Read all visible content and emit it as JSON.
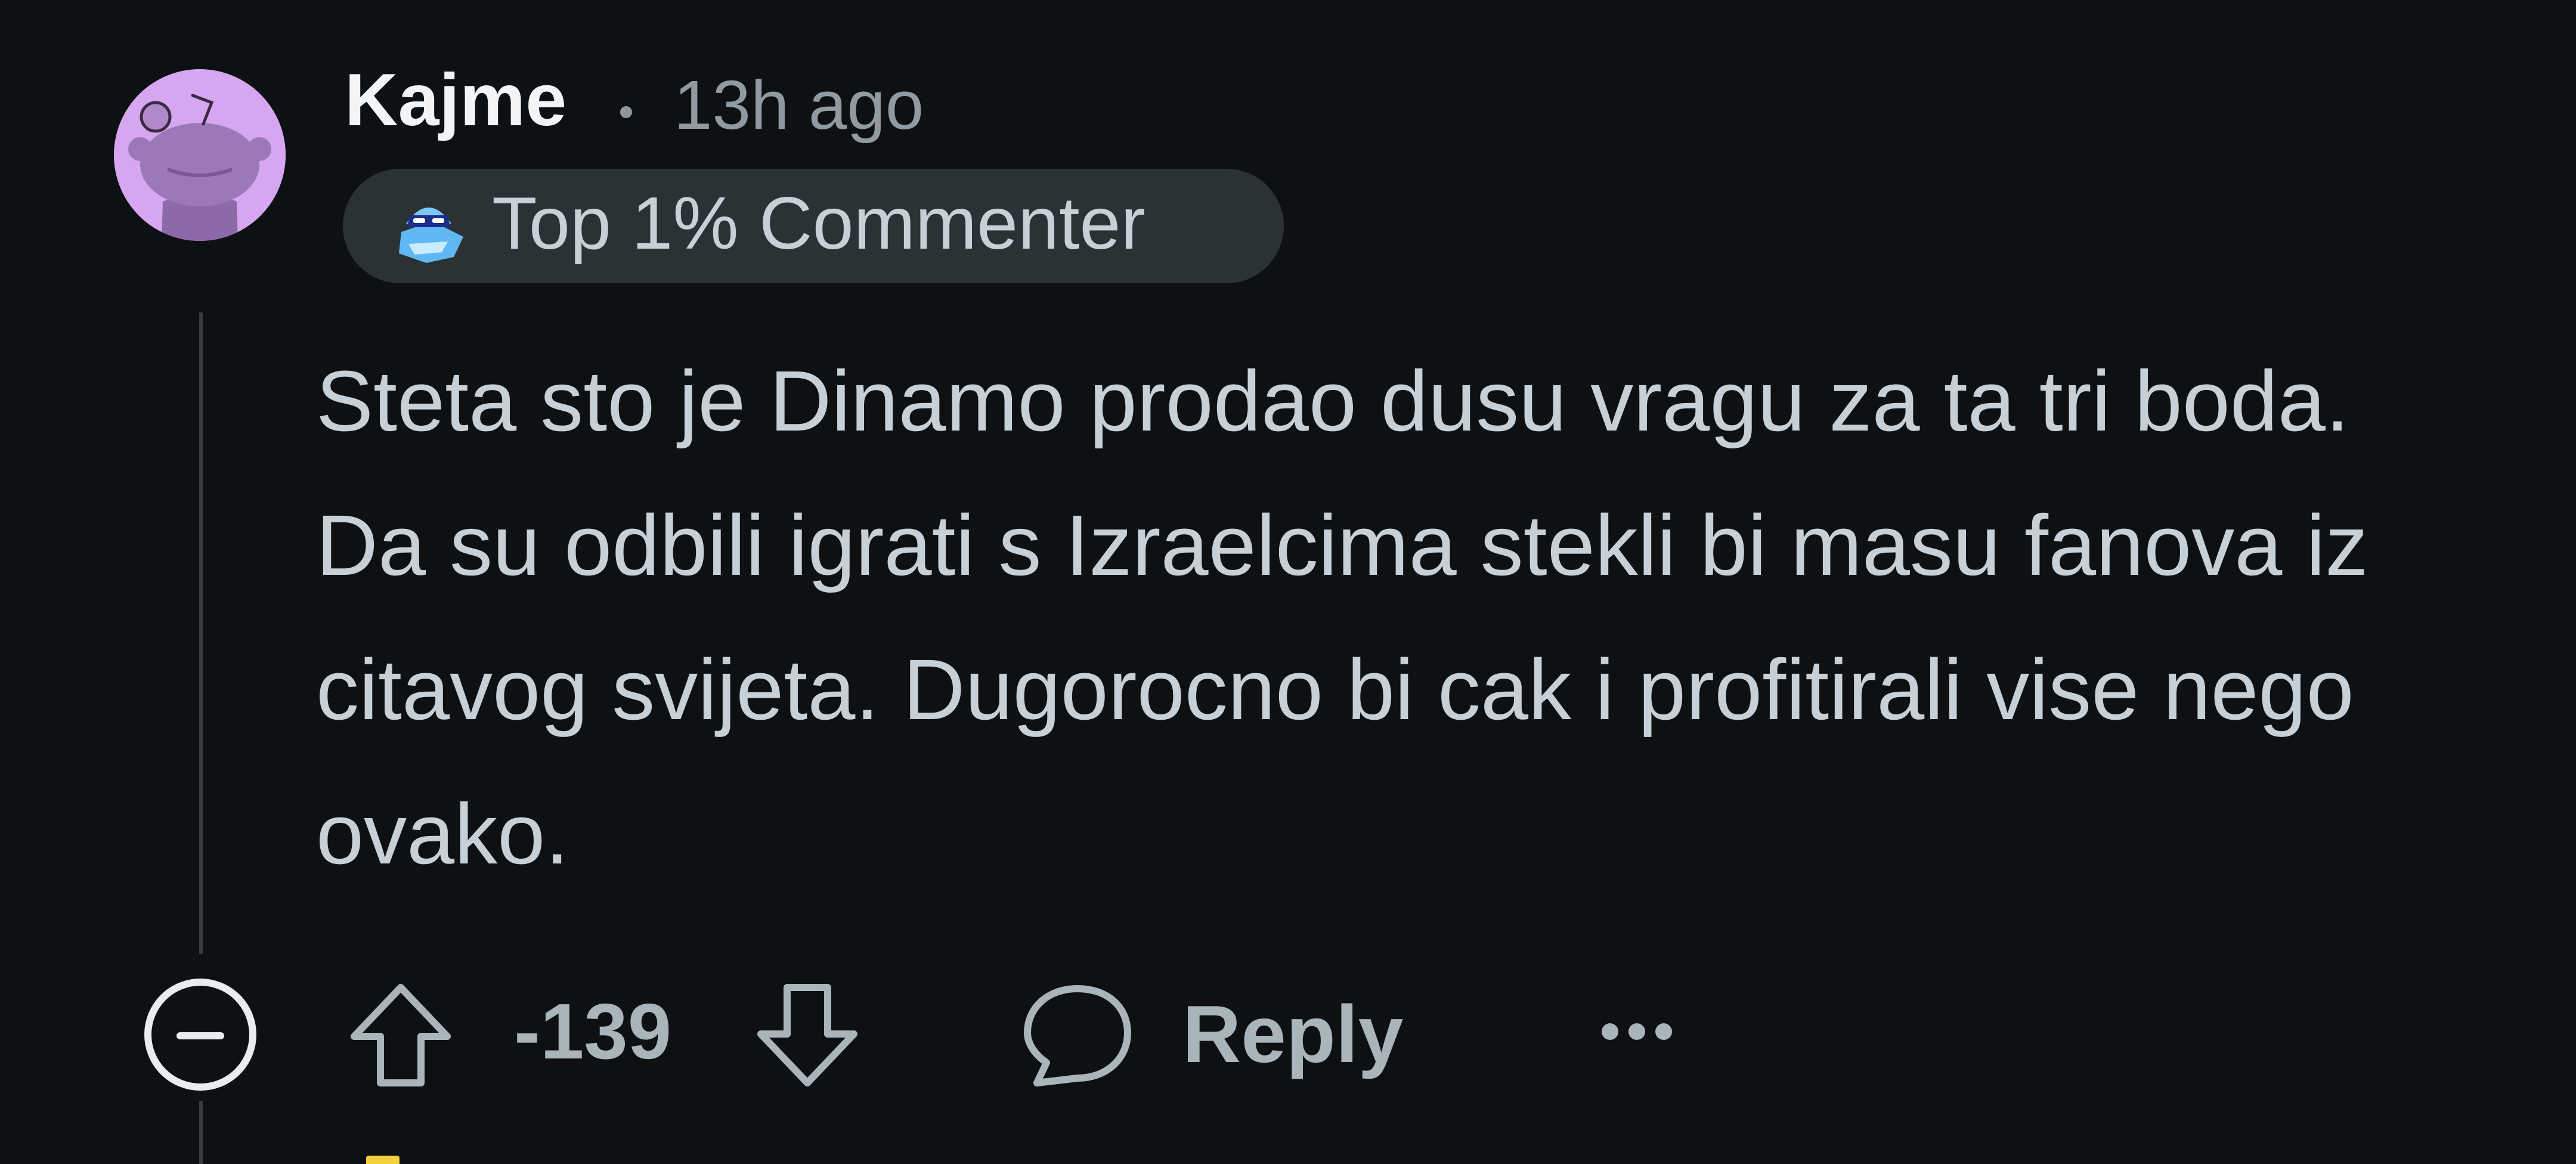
{
  "comment": {
    "author": "Kajme",
    "separator": "•",
    "timestamp": "13h ago",
    "avatar_icon": "snoo-avatar-icon",
    "flair": {
      "icon": "top-commenter-badge-icon",
      "label": "Top 1% Commenter"
    },
    "body": "Steta sto je Dinamo prodao dusu vragu za ta tri boda. Da su odbili igrati s Izraelcima stekli bi masu fanova iz citavog svijeta. Dugorocno bi cak i profitirali vise nego ovako.",
    "actions": {
      "collapse_icon": "minus-circle-icon",
      "upvote_icon": "arrow-up-icon",
      "score": "-139",
      "downvote_icon": "arrow-down-icon",
      "reply_icon": "speech-bubble-icon",
      "reply_label": "Reply",
      "more_icon": "ellipsis-icon"
    }
  },
  "colors": {
    "background": "#0e1113",
    "avatar_background": "#d7a6f0",
    "flair_background": "#2a3236",
    "username": "#f2f4f5",
    "body_text": "#c6d0d6",
    "muted_text": "#8f9aa1",
    "thread_line": "#353d42"
  }
}
